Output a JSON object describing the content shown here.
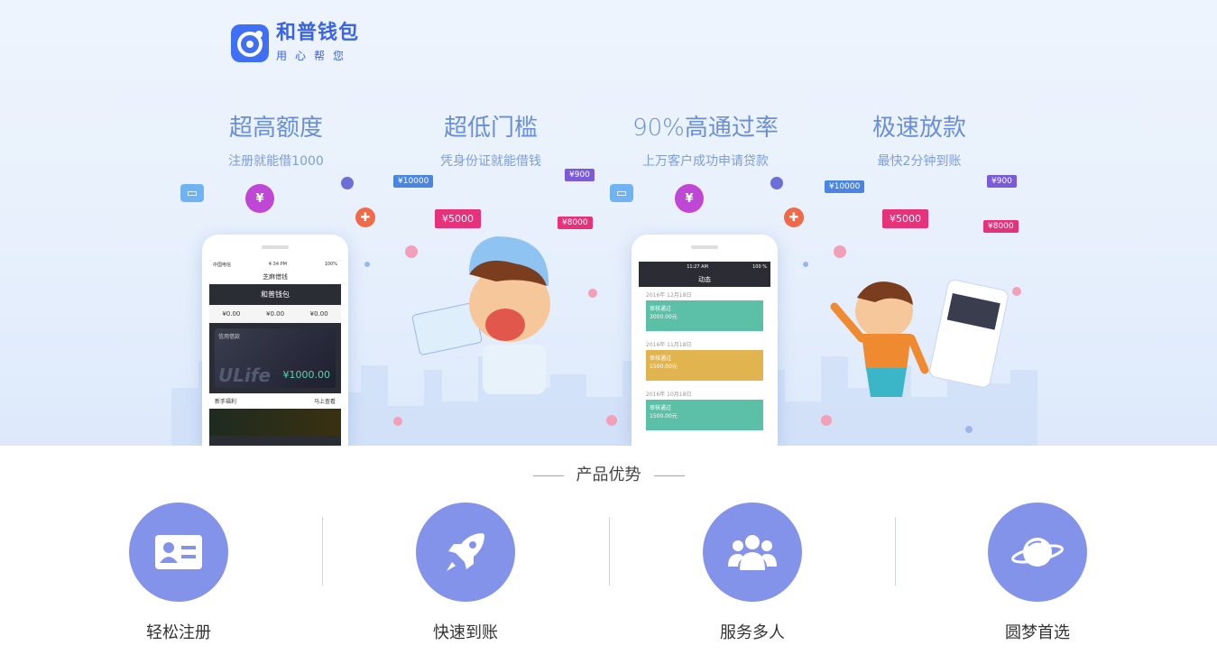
{
  "brand": {
    "name": "和普钱包",
    "slogan": "用心帮您"
  },
  "features": [
    {
      "title": "超高额度",
      "subtitle": "注册就能借1000"
    },
    {
      "title": "超低门槛",
      "subtitle": "凭身份证就能借钱"
    },
    {
      "title": "90%高通过率",
      "subtitle": "上万客户成功申请贷款"
    },
    {
      "title": "极速放款",
      "subtitle": "最快2分钟到账"
    }
  ],
  "tags": {
    "t1": "¥5000",
    "t2": "¥10000",
    "t3": "¥900",
    "t4": "¥8000",
    "t5": "¥5000",
    "t6": "¥10000",
    "t7": "¥900",
    "t8": "¥8000"
  },
  "phone1": {
    "carrier": "中国电信",
    "time": "4:34 PM",
    "battery": "100%",
    "title": "芝麻借钱",
    "app_name": "和普钱包",
    "stats": [
      "¥0.00",
      "¥0.00",
      "¥0.00"
    ],
    "card_label": "信用借款",
    "card_amount": "¥1000.00",
    "card_brand": "ULife",
    "list_item": "新手福利",
    "list_action": "马上查看"
  },
  "phone2": {
    "time": "11:27 AM",
    "battery": "100 %",
    "title": "动态",
    "records": [
      {
        "date": "2016年 12月18日",
        "status": "审核通过",
        "amount": "3000.00元",
        "color": "#5cc0a8"
      },
      {
        "date": "2016年 11月18日",
        "status": "审核通过",
        "amount": "1500.00元",
        "color": "#e2b450"
      },
      {
        "date": "2016年 10月18日",
        "status": "审核通过",
        "amount": "1500.00元",
        "color": "#5cc0a8"
      }
    ]
  },
  "section": {
    "title": "产品优势"
  },
  "advantages": [
    {
      "label": "轻松注册",
      "icon": "id-card-icon"
    },
    {
      "label": "快速到账",
      "icon": "rocket-icon"
    },
    {
      "label": "服务多人",
      "icon": "users-icon"
    },
    {
      "label": "圆梦首选",
      "icon": "planet-icon"
    }
  ],
  "colors": {
    "accent": "#8493ea",
    "brand": "#3a63e8",
    "feature_text": "#6a8fd6"
  }
}
